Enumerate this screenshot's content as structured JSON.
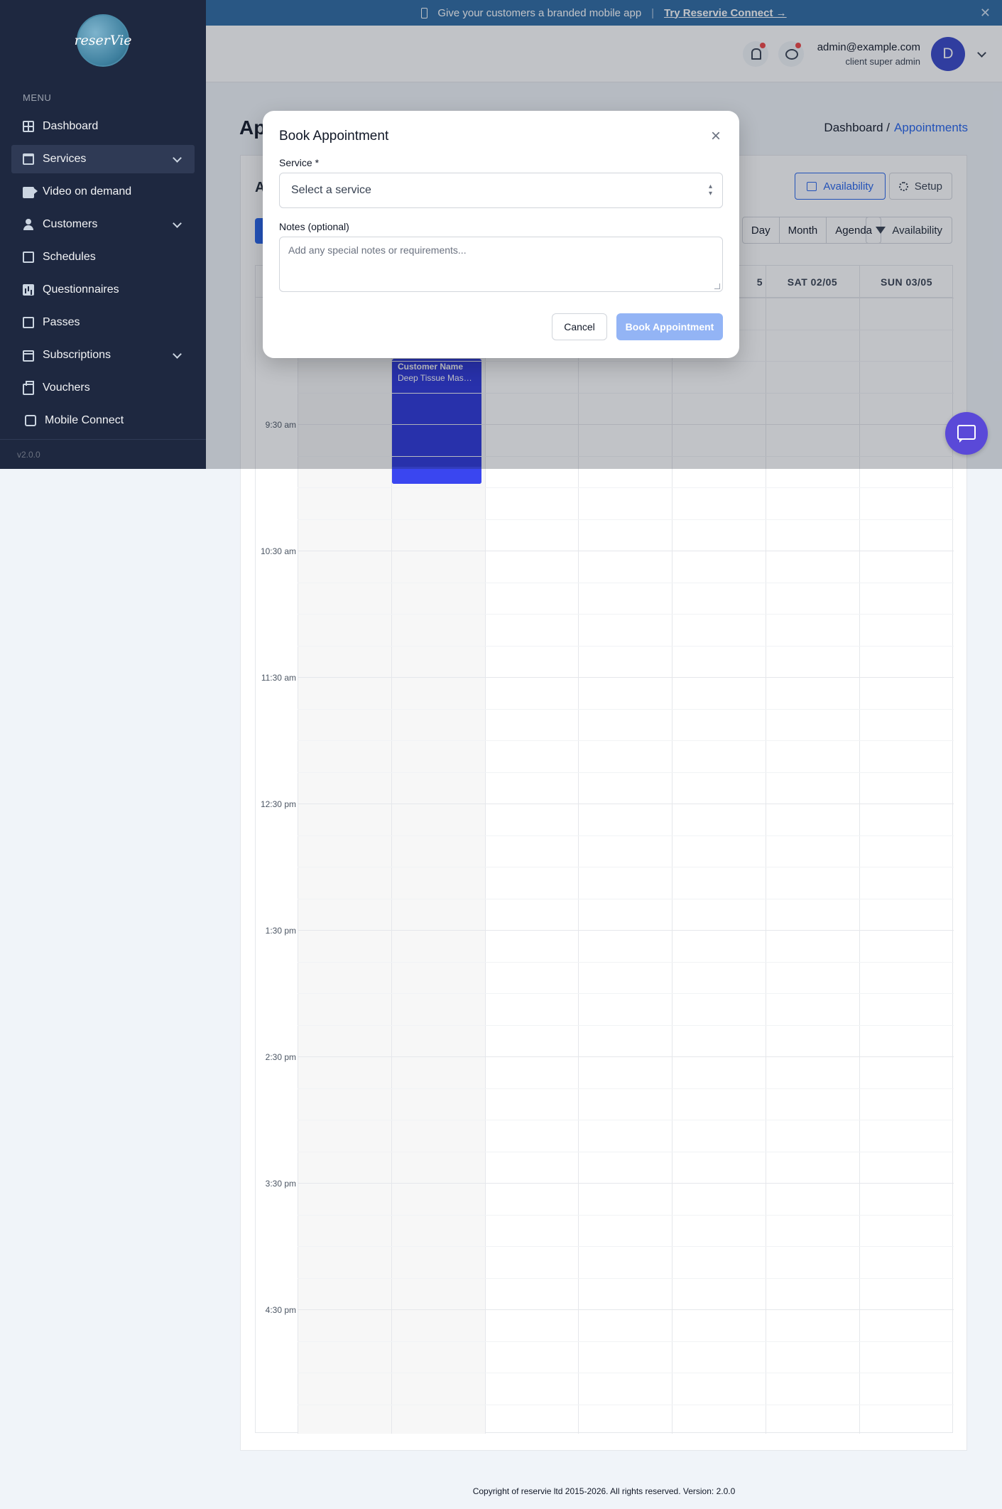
{
  "sidebar": {
    "logo_text": "reserVie",
    "menu_label": "MENU",
    "items": [
      {
        "label": "Dashboard",
        "icon": "grid-icon"
      },
      {
        "label": "Services",
        "icon": "calendar-icon",
        "active": true,
        "expandable": true
      },
      {
        "label": "Video on demand",
        "icon": "video-icon"
      },
      {
        "label": "Customers",
        "icon": "user-icon",
        "expandable": true
      },
      {
        "label": "Schedules",
        "icon": "document-icon"
      },
      {
        "label": "Questionnaires",
        "icon": "bar-chart-icon"
      },
      {
        "label": "Passes",
        "icon": "document-icon"
      },
      {
        "label": "Subscriptions",
        "icon": "card-icon",
        "expandable": true
      },
      {
        "label": "Vouchers",
        "icon": "printer-icon"
      },
      {
        "label": "Mobile Connect",
        "icon": "phone-icon"
      }
    ],
    "version": "v2.0.0"
  },
  "banner": {
    "text": "Give your customers a branded mobile app",
    "separator": "|",
    "cta": "Try Reservie Connect →",
    "close": "✕"
  },
  "topbar": {
    "email": "admin@example.com",
    "role": "client super admin",
    "avatar_letter": "D"
  },
  "page": {
    "title": "Ap",
    "breadcrumb_root": "Dashboard /",
    "breadcrumb_current": "Appointments"
  },
  "toolbar": {
    "card_title": "A",
    "availability": "Availability",
    "setup": "Setup",
    "views": [
      "Day",
      "Month",
      "Agenda"
    ],
    "filter": "Availability"
  },
  "calendar": {
    "days": [
      "",
      "",
      "",
      "5",
      "SAT 02/05",
      "SUN 03/05"
    ],
    "times": [
      "9:30 am",
      "10:30 am",
      "11:30 am",
      "12:30 pm",
      "1:30 pm",
      "2:30 pm",
      "3:30 pm",
      "4:30 pm"
    ],
    "event": {
      "customer": "Customer Name",
      "service": "Deep Tissue Massage"
    }
  },
  "modal": {
    "title": "Book Appointment",
    "close": "×",
    "service_label": "Service *",
    "service_placeholder": "Select a service",
    "notes_label": "Notes (optional)",
    "notes_placeholder": "Add any special notes or requirements...",
    "cancel": "Cancel",
    "submit": "Book Appointment"
  },
  "footer": {
    "text": "Copyright of reservie ltd 2015-2026. All rights reserved. Version: 2.0.0"
  }
}
